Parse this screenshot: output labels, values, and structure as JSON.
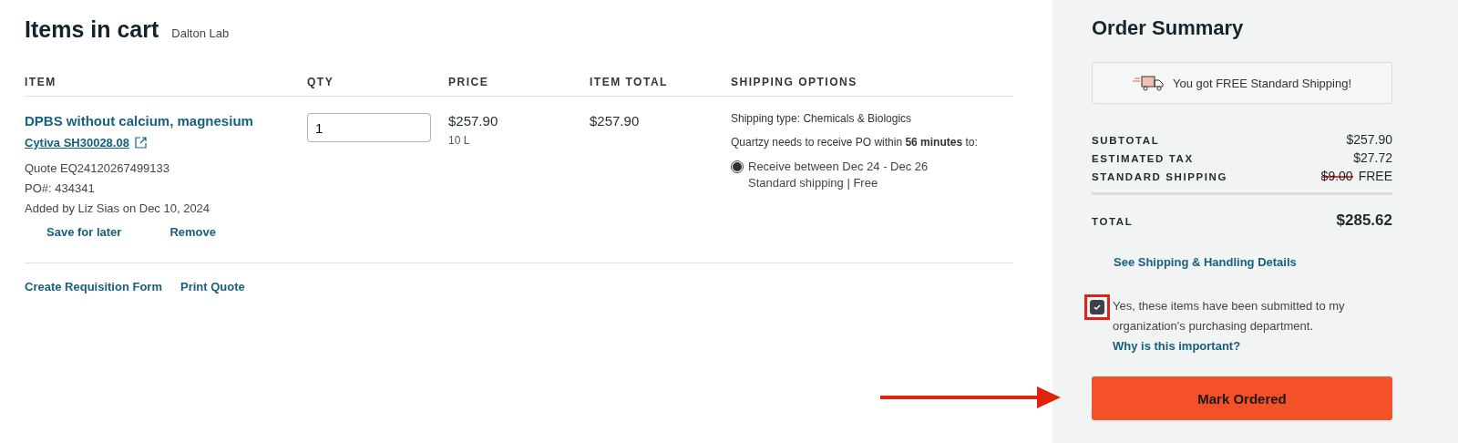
{
  "cart": {
    "title": "Items in cart",
    "lab": "Dalton Lab",
    "columns": [
      "ITEM",
      "QTY",
      "PRICE",
      "ITEM TOTAL",
      "SHIPPING OPTIONS"
    ],
    "items": [
      {
        "name": "DPBS without calcium, magnesium",
        "catalog": "Cytiva SH30028.08",
        "quote": "Quote EQ24120267499133",
        "po": "PO#: 434341",
        "added": "Added by Liz Sias on Dec 10, 2024",
        "actions": [
          "Save for later",
          "Remove"
        ],
        "qty": "1",
        "price": "$257.90",
        "unit": "10 L",
        "total": "$257.90",
        "shipping_type": "Shipping type: Chemicals & Biologics",
        "deadline": "Quartzy needs to receive PO within **56 minutes** to:",
        "options": [
          {
            "label": "Receive between Dec 24 - Dec 26",
            "detail": "Standard shipping | Free",
            "selected": true
          }
        ]
      }
    ],
    "links": [
      "Create Requisition Form",
      "Print Quote"
    ]
  },
  "summary": {
    "title": "Order Summary",
    "banner": "You got FREE Standard Shipping!",
    "lines": [
      {
        "label": "SUBTOTAL",
        "value": "$257.90"
      },
      {
        "label": "ESTIMATED TAX",
        "value": "$27.72"
      },
      {
        "label": "STANDARD SHIPPING",
        "old_value": "$9.00",
        "value": "FREE"
      }
    ],
    "total": {
      "label": "TOTAL",
      "value": "$285.62"
    },
    "details_link": "See Shipping & Handling Details",
    "confirm": {
      "text": "Yes, these items have been submitted to my organization's purchasing department.",
      "link": "Why is this important?",
      "checked": true,
      "highlighted": true
    },
    "button": "Mark Ordered"
  },
  "annotation": {
    "kind": "arrow"
  }
}
